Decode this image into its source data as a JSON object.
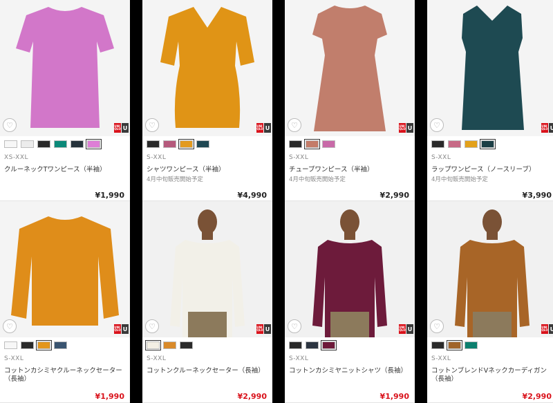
{
  "products": [
    {
      "size": "XS-XXL",
      "name": "クルーネックTワンピース（半袖）",
      "note": "",
      "price": "¥1,990",
      "price_color": "#222222",
      "swatches": [
        "#f7f7f7",
        "#ececec",
        "#2a2a2a",
        "#0c8a7a",
        "#26323b",
        "#de7ed6"
      ],
      "selected": 5,
      "garment_color": "#d277c9",
      "icon": "heart-icon"
    },
    {
      "size": "S-XXL",
      "name": "シャツワンピース（半袖）",
      "note": "4月中旬販売開始予定",
      "price": "¥4,990",
      "price_color": "#222222",
      "swatches": [
        "#2a2a2a",
        "#b55a7c",
        "#e39a1e",
        "#1f4752"
      ],
      "selected": 2,
      "garment_color": "#e09416",
      "icon": "heart-icon"
    },
    {
      "size": "S-XXL",
      "name": "チューブワンピース（半袖）",
      "note": "4月中旬販売開始予定",
      "price": "¥2,990",
      "price_color": "#222222",
      "swatches": [
        "#2a2a2a",
        "#c47c69",
        "#c86aa8"
      ],
      "selected": 1,
      "garment_color": "#c17e6c",
      "icon": "heart-icon"
    },
    {
      "size": "S-XXL",
      "name": "ラップワンピース（ノースリーブ）",
      "note": "4月中旬販売開始予定",
      "price": "¥3,990",
      "price_color": "#222222",
      "swatches": [
        "#2a2a2a",
        "#c76a86",
        "#e3a11a",
        "#1c3f45"
      ],
      "selected": 3,
      "garment_color": "#1e4a52",
      "icon": "heart-icon"
    },
    {
      "size": "S-XXL",
      "name": "コットンカシミヤクルーネックセーター（長袖）",
      "note": "",
      "price": "¥1,990",
      "price_color": "#d9121b",
      "swatches": [
        "#f7f7f7",
        "#2a2a2a",
        "#e3961c",
        "#3a5470"
      ],
      "selected": 2,
      "garment_color": "#df8d1a",
      "icon": "heart-icon"
    },
    {
      "size": "S-XXL",
      "name": "コットンクルーネックセーター（長袖）",
      "note": "",
      "price": "¥2,990",
      "price_color": "#d9121b",
      "swatches": [
        "#f3efe4",
        "#d98a2a",
        "#2a2a2a"
      ],
      "selected": 0,
      "garment_color": "#f2f0e8",
      "icon": "heart-icon"
    },
    {
      "size": "S-XXL",
      "name": "コットンカシミヤニットシャツ（長袖）",
      "note": "",
      "price": "¥1,990",
      "price_color": "#d9121b",
      "swatches": [
        "#2a2a2a",
        "#2c3440",
        "#6e1a3a"
      ],
      "selected": 2,
      "garment_color": "#6d1b3b",
      "icon": "heart-icon"
    },
    {
      "size": "S-XXL",
      "name": "コットンブレンドVネックカーディガン（長袖）",
      "note": "",
      "price": "¥2,990",
      "price_color": "#d9121b",
      "swatches": [
        "#2a2a2a",
        "#a0642a",
        "#0c7f6e"
      ],
      "selected": 1,
      "garment_color": "#a86527",
      "icon": "heart-icon"
    }
  ],
  "brand": {
    "logo_text": "UNI QLO",
    "u_text": "U"
  }
}
